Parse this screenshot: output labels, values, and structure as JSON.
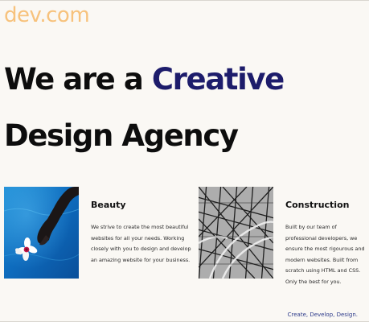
{
  "header": {
    "logo": "dev.com"
  },
  "hero": {
    "line1_prefix": "We are a ",
    "line1_accent": "Creative",
    "line2": "Design Agency"
  },
  "services": [
    {
      "title": "Beauty",
      "description": "We strive to create the most beautiful websites for all your needs. Working closely with you to design and develop an amazing website for your business."
    },
    {
      "title": "Construction",
      "description": "Built by our team of professional developers, we ensure the most rigourous and modern websites. Built from scratch using HTML and CSS. Only the best for you."
    }
  ],
  "footer": {
    "tagline": "Create, Develop, Design."
  },
  "colors": {
    "logo": "#f7c27c",
    "accent": "#1d1c6b",
    "tagline": "#2c3a8a",
    "background": "#faf8f4"
  }
}
